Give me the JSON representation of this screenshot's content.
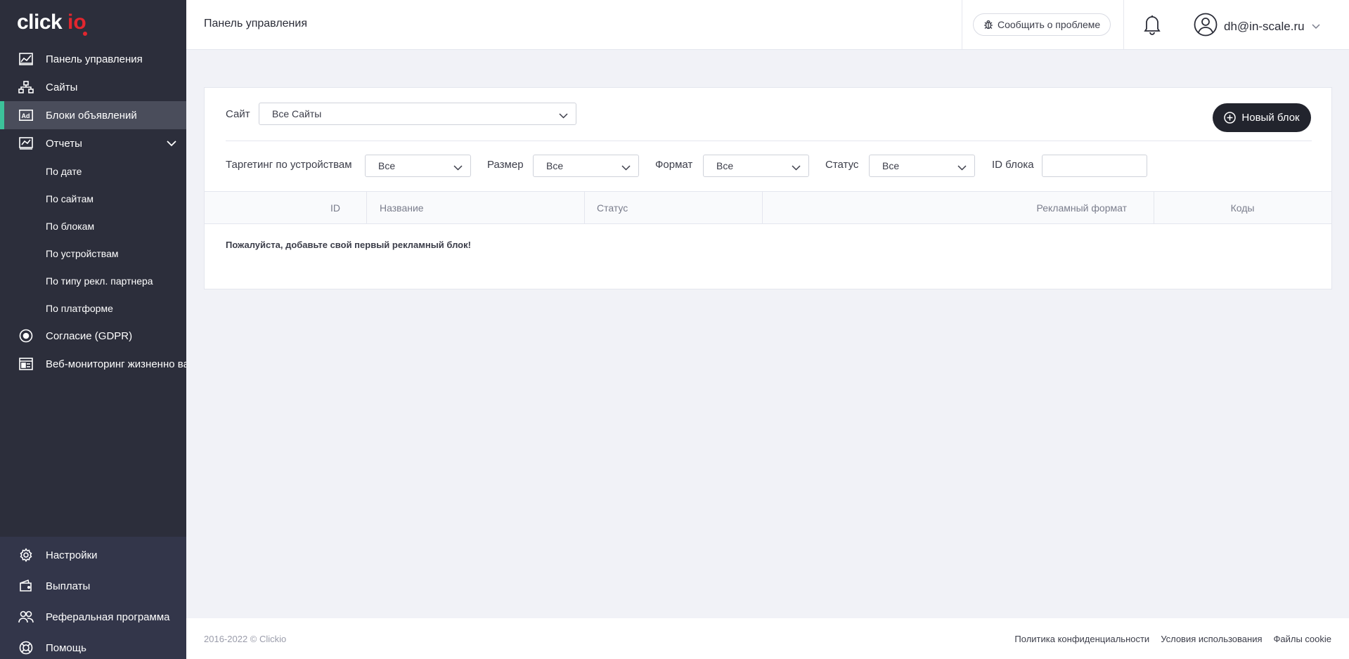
{
  "brand": {
    "name": "clickio",
    "accent": "#e3262e",
    "sidebar_bg": "#2c2e3b",
    "active_marker": "#3cc29a"
  },
  "sidebar": {
    "items": [
      {
        "label": "Панель управления",
        "icon": "dashboard-chart-icon"
      },
      {
        "label": "Сайты",
        "icon": "sitemap-icon"
      },
      {
        "label": "Блоки объявлений",
        "icon": "ad-icon",
        "active": true
      },
      {
        "label": "Отчеты",
        "icon": "report-chart-icon",
        "expanded": true
      }
    ],
    "report_subitems": [
      "По дате",
      "По сайтам",
      "По блокам",
      "По устройствам",
      "По типу рекл. партнера",
      "По платформе"
    ],
    "extra_items": [
      {
        "label": "Согласие (GDPR)",
        "icon": "consent-icon"
      },
      {
        "label": "Веб-мониторинг жизненно важных показателей",
        "icon": "web-vitals-icon"
      }
    ],
    "bottom_items": [
      {
        "label": "Настройки",
        "icon": "gear-icon"
      },
      {
        "label": "Выплаты",
        "icon": "wallet-icon"
      },
      {
        "label": "Реферальная программа",
        "icon": "users-icon"
      },
      {
        "label": "Помощь",
        "icon": "lifebuoy-icon"
      }
    ]
  },
  "header": {
    "title": "Панель управления",
    "report_problem": "Сообщить о проблеме",
    "user_email": "dh@in-scale.ru"
  },
  "filters": {
    "site_label": "Сайт",
    "site_value": "Все Сайты",
    "new_block": "Новый блок",
    "targeting_label": "Таргетинг по устройствам",
    "targeting_value": "Все",
    "size_label": "Размер",
    "size_value": "Все",
    "format_label": "Формат",
    "format_value": "Все",
    "status_label": "Статус",
    "status_value": "Все",
    "block_id_label": "ID блока",
    "block_id_value": ""
  },
  "table": {
    "columns": [
      "ID",
      "Название",
      "Статус",
      "Рекламный формат",
      "Коды"
    ],
    "rows": [],
    "empty_message": "Пожалуйста, добавьте свой первый рекламный блок!"
  },
  "footer": {
    "copyright": "2016-2022 © Clickio",
    "links": [
      "Политика конфиденциальности",
      "Условия использования",
      "Файлы cookie"
    ]
  }
}
